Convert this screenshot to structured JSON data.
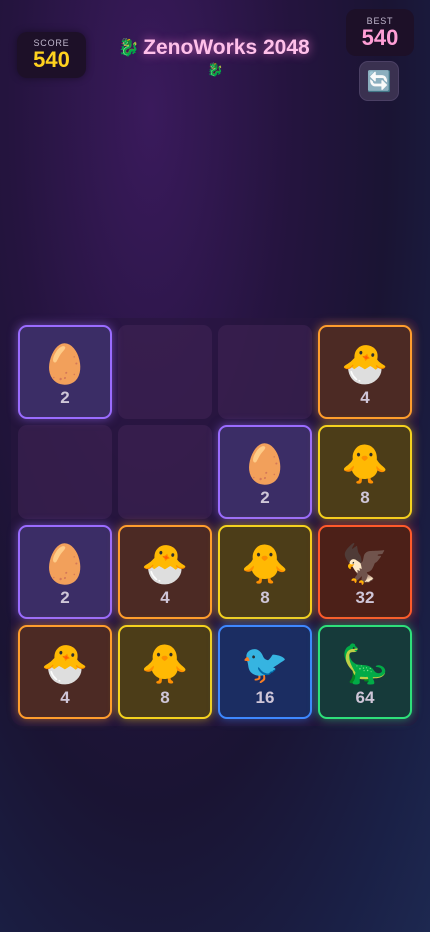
{
  "header": {
    "score_label": "SCORE",
    "score_value": "540",
    "best_label": "BEST",
    "best_value": "540",
    "title_icon": "🐉",
    "title": "ZenoWorks 2048",
    "subtitle_icon": "🐉",
    "restart_icon": "🔄"
  },
  "board": {
    "rows": 4,
    "cols": 4,
    "cells": [
      {
        "value": "2",
        "emoji": "🥚"
      },
      null,
      null,
      {
        "value": "4",
        "emoji": "🐣"
      },
      null,
      null,
      {
        "value": "2",
        "emoji": "🥚"
      },
      {
        "value": "8",
        "emoji": "🐥"
      },
      {
        "value": "2",
        "emoji": "🥚"
      },
      {
        "value": "4",
        "emoji": "🐣"
      },
      {
        "value": "8",
        "emoji": "🐥"
      },
      {
        "value": "32",
        "emoji": "🦅"
      },
      {
        "value": "4",
        "emoji": "🐣"
      },
      {
        "value": "8",
        "emoji": "🐥"
      },
      {
        "value": "16",
        "emoji": "🐦"
      },
      {
        "value": "64",
        "emoji": "🦕"
      }
    ]
  },
  "colors": {
    "tile_2": "#9a6cff",
    "tile_4": "#ff9d2d",
    "tile_8": "#f5d21e",
    "tile_16": "#3e88ff",
    "tile_32": "#ff5a2a",
    "tile_64": "#2ee07a",
    "score_value": "#ffd21f",
    "best_value": "#ff9ed6"
  }
}
